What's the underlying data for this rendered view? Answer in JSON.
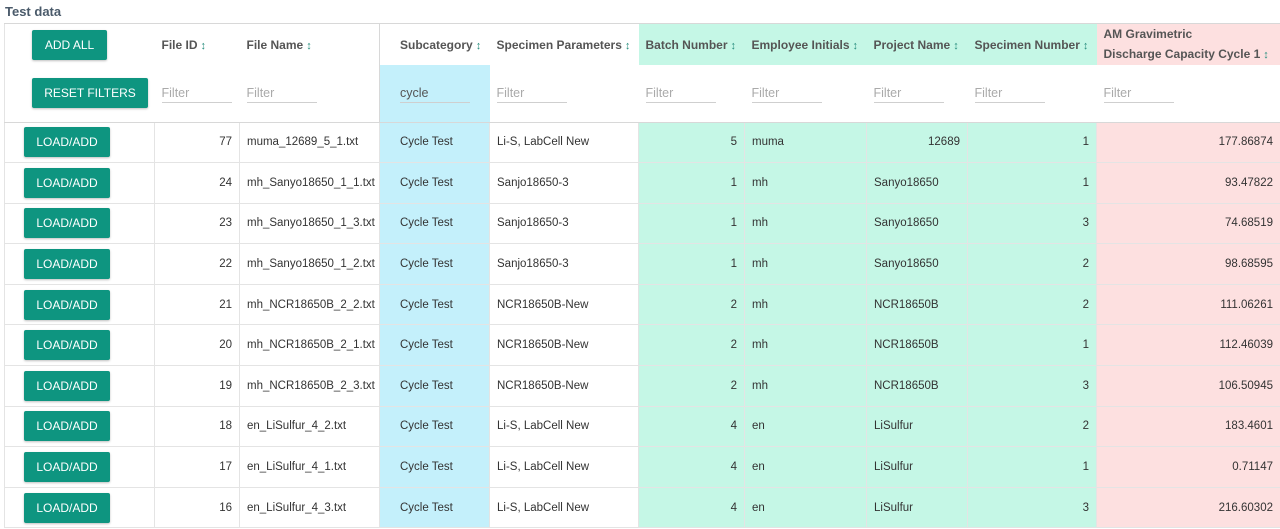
{
  "page": {
    "title": "Test data"
  },
  "toolbar": {
    "add_all_label": "ADD ALL",
    "reset_filters_label": "RESET FILTERS",
    "load_add_label": "LOAD/ADD"
  },
  "sort_icon": "↕",
  "columns": [
    {
      "key": "file_id",
      "label": "File ID",
      "filter": ""
    },
    {
      "key": "file_name",
      "label": "File Name",
      "filter": ""
    },
    {
      "key": "subcategory",
      "label": "Subcategory",
      "filter": "cycle"
    },
    {
      "key": "specimen_parameters",
      "label": "Specimen Parameters",
      "filter": ""
    },
    {
      "key": "batch_number",
      "label": "Batch Number",
      "filter": ""
    },
    {
      "key": "employee_initials",
      "label": "Employee Initials",
      "filter": ""
    },
    {
      "key": "project_name",
      "label": "Project Name",
      "filter": ""
    },
    {
      "key": "specimen_number",
      "label": "Specimen Number",
      "filter": ""
    },
    {
      "key": "am_gravimetric",
      "label_line1": "AM Gravimetric",
      "label_line2": "Discharge Capacity Cycle 1",
      "filter": ""
    }
  ],
  "filter_placeholder": "Filter",
  "colors": {
    "button": "#0e9580",
    "subcategory_col": "#c4f0fb",
    "metadata_cols": "#c5f7e6",
    "result_col": "#fde0e0"
  },
  "rows": [
    {
      "file_id": "77",
      "file_name": "muma_12689_5_1.txt",
      "subcategory": "Cycle Test",
      "specimen_parameters": "Li-S, LabCell New",
      "batch_number": "5",
      "employee_initials": "muma",
      "project_name": "12689",
      "specimen_number": "1",
      "am_gravimetric": "177.86874"
    },
    {
      "file_id": "24",
      "file_name": "mh_Sanyo18650_1_1.txt",
      "subcategory": "Cycle Test",
      "specimen_parameters": "Sanjo18650-3",
      "batch_number": "1",
      "employee_initials": "mh",
      "project_name": "Sanyo18650",
      "specimen_number": "1",
      "am_gravimetric": "93.47822"
    },
    {
      "file_id": "23",
      "file_name": "mh_Sanyo18650_1_3.txt",
      "subcategory": "Cycle Test",
      "specimen_parameters": "Sanjo18650-3",
      "batch_number": "1",
      "employee_initials": "mh",
      "project_name": "Sanyo18650",
      "specimen_number": "3",
      "am_gravimetric": "74.68519"
    },
    {
      "file_id": "22",
      "file_name": "mh_Sanyo18650_1_2.txt",
      "subcategory": "Cycle Test",
      "specimen_parameters": "Sanjo18650-3",
      "batch_number": "1",
      "employee_initials": "mh",
      "project_name": "Sanyo18650",
      "specimen_number": "2",
      "am_gravimetric": "98.68595"
    },
    {
      "file_id": "21",
      "file_name": "mh_NCR18650B_2_2.txt",
      "subcategory": "Cycle Test",
      "specimen_parameters": "NCR18650B-New",
      "batch_number": "2",
      "employee_initials": "mh",
      "project_name": "NCR18650B",
      "specimen_number": "2",
      "am_gravimetric": "111.06261"
    },
    {
      "file_id": "20",
      "file_name": "mh_NCR18650B_2_1.txt",
      "subcategory": "Cycle Test",
      "specimen_parameters": "NCR18650B-New",
      "batch_number": "2",
      "employee_initials": "mh",
      "project_name": "NCR18650B",
      "specimen_number": "1",
      "am_gravimetric": "112.46039"
    },
    {
      "file_id": "19",
      "file_name": "mh_NCR18650B_2_3.txt",
      "subcategory": "Cycle Test",
      "specimen_parameters": "NCR18650B-New",
      "batch_number": "2",
      "employee_initials": "mh",
      "project_name": "NCR18650B",
      "specimen_number": "3",
      "am_gravimetric": "106.50945"
    },
    {
      "file_id": "18",
      "file_name": "en_LiSulfur_4_2.txt",
      "subcategory": "Cycle Test",
      "specimen_parameters": "Li-S, LabCell New",
      "batch_number": "4",
      "employee_initials": "en",
      "project_name": "LiSulfur",
      "specimen_number": "2",
      "am_gravimetric": "183.4601"
    },
    {
      "file_id": "17",
      "file_name": "en_LiSulfur_4_1.txt",
      "subcategory": "Cycle Test",
      "specimen_parameters": "Li-S, LabCell New",
      "batch_number": "4",
      "employee_initials": "en",
      "project_name": "LiSulfur",
      "specimen_number": "1",
      "am_gravimetric": "0.71147"
    },
    {
      "file_id": "16",
      "file_name": "en_LiSulfur_4_3.txt",
      "subcategory": "Cycle Test",
      "specimen_parameters": "Li-S, LabCell New",
      "batch_number": "4",
      "employee_initials": "en",
      "project_name": "LiSulfur",
      "specimen_number": "3",
      "am_gravimetric": "216.60302"
    }
  ]
}
